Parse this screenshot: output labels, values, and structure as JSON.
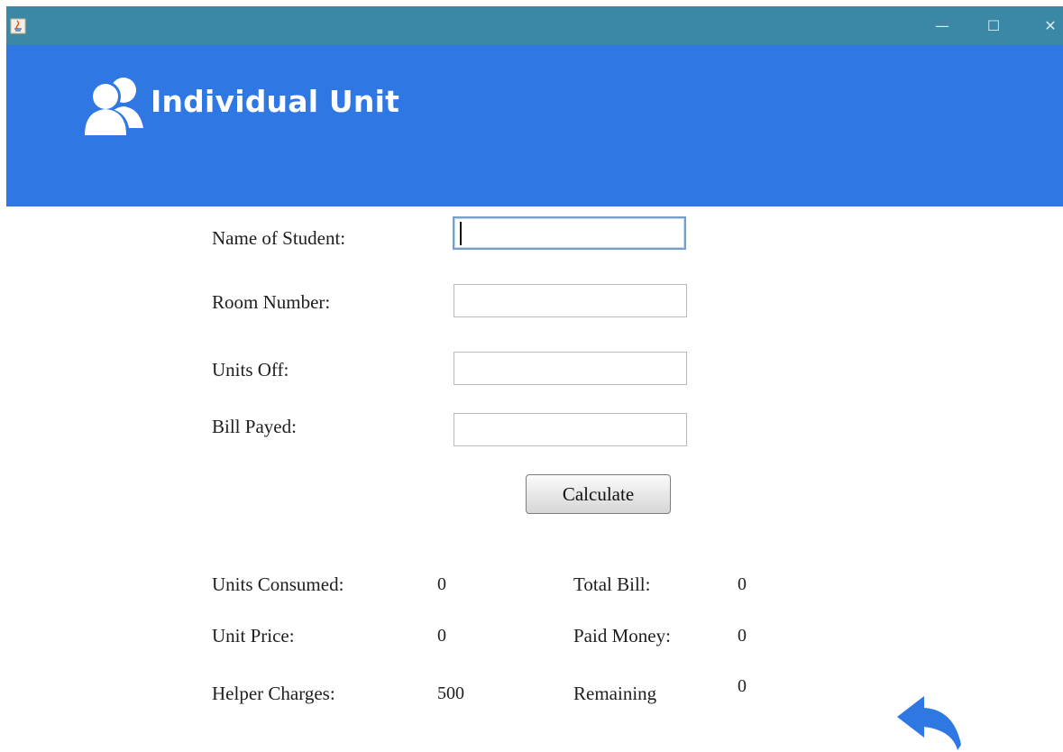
{
  "window": {
    "app_icon": "java-icon",
    "controls": {
      "minimize": "—",
      "maximize": "☐",
      "close": "✕"
    }
  },
  "header": {
    "title": "Individual Unit",
    "icon": "users-icon",
    "background": "#2f78e4",
    "titlebar_color": "#3a88a5"
  },
  "form": {
    "name_label": "Name of Student:",
    "name_value": "",
    "room_label": "Room Number:",
    "room_value": "",
    "units_label": "Units Off:",
    "units_value": "",
    "bill_label": "Bill Payed:",
    "bill_value": "",
    "calculate_label": "Calculate"
  },
  "summary": {
    "units_consumed_label": "Units Consumed:",
    "units_consumed_value": "0",
    "unit_price_label": "Unit Price:",
    "unit_price_value": "0",
    "helper_charges_label": "Helper Charges:",
    "helper_charges_value": "500",
    "total_bill_label": "Total Bill:",
    "total_bill_value": "0",
    "paid_money_label": "Paid Money:",
    "paid_money_value": "0",
    "remaining_label": "Remaining",
    "remaining_value": "0"
  },
  "back_icon": "back-arrow-icon"
}
